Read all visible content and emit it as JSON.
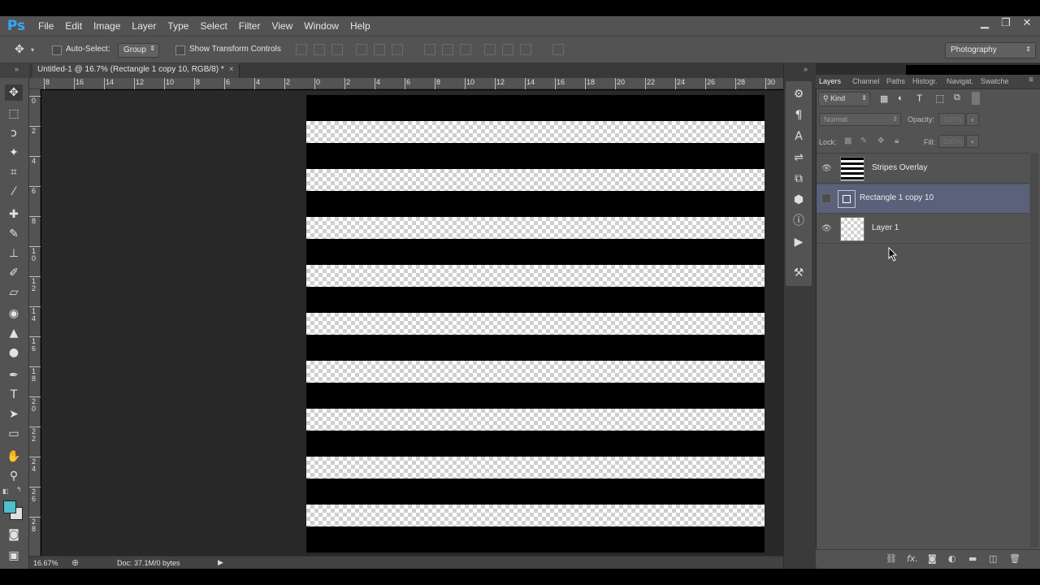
{
  "app": {
    "logo": "Ps"
  },
  "menu": [
    "File",
    "Edit",
    "Image",
    "Layer",
    "Type",
    "Select",
    "Filter",
    "View",
    "Window",
    "Help"
  ],
  "window_controls": {
    "minimize": "▁",
    "restore": "❐",
    "close": "✕"
  },
  "options_bar": {
    "auto_select_label": "Auto-Select:",
    "auto_select_value": "Group",
    "show_transform_label": "Show Transform Controls"
  },
  "workspace": "Photography",
  "document": {
    "tab_title": "Untitled-1 @ 16.7% (Rectangle 1 copy 10, RGB/8) *",
    "close": "×"
  },
  "ruler_h": [
    "8",
    "16",
    "14",
    "12",
    "10",
    "8",
    "6",
    "4",
    "2",
    "0",
    "2",
    "4",
    "6",
    "8",
    "10",
    "12",
    "14",
    "16",
    "18",
    "20",
    "22",
    "24",
    "26",
    "28",
    "30"
  ],
  "ruler_v": [
    "0",
    "2",
    "4",
    "6",
    "8",
    "1\n0",
    "1\n2",
    "1\n4",
    "1\n6",
    "1\n8",
    "2\n0",
    "2\n2",
    "2\n4",
    "2\n6",
    "2\n8"
  ],
  "status": {
    "zoom": "16.67%",
    "doc": "Doc: 37.1M/0 bytes"
  },
  "layers_panel": {
    "tabs": [
      "Layers",
      "Channel",
      "Paths",
      "Histogr.",
      "Navigat.",
      "Swatche"
    ],
    "filter_kind": "Kind",
    "blend_mode": "Normal",
    "opacity_label": "Opacity:",
    "opacity_value": "100%",
    "lock_label": "Lock:",
    "fill_label": "Fill:",
    "fill_value": "100%",
    "layers": [
      {
        "name": "Stripes Overlay",
        "visible": true
      },
      {
        "name": "Rectangle 1 copy 10",
        "visible": false,
        "selected": true
      },
      {
        "name": "Layer 1",
        "visible": true
      }
    ]
  },
  "colors": {
    "foreground": "#4fbfc9",
    "background": "#e0e0e0",
    "selected_layer": "#59627a"
  }
}
